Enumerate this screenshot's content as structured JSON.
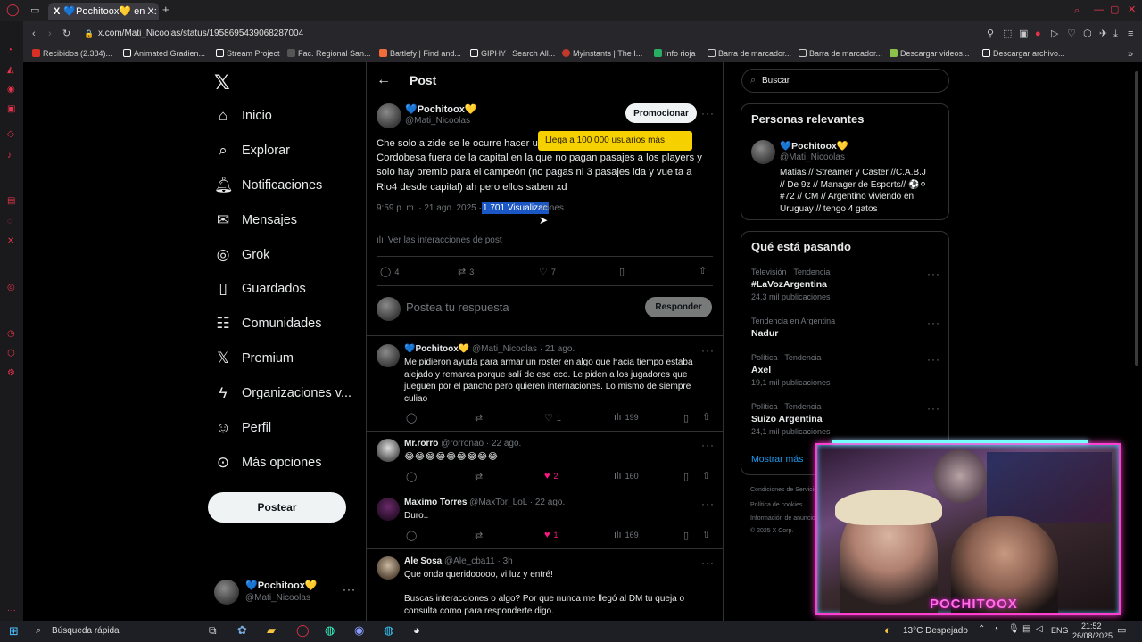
{
  "browser": {
    "tabs": [
      {
        "label": "💙Pochitoox💛 en X: \"Ch"
      }
    ],
    "url": "x.com/Mati_Nicoolas/status/1958695439068287004",
    "bookmarks": [
      {
        "label": "Recibidos (2.384)...",
        "color": "#d93025"
      },
      {
        "label": "Animated Gradien...",
        "color": "#ffffff"
      },
      {
        "label": "Stream Project",
        "color": "#ffffff"
      },
      {
        "label": "Fac. Regional San...",
        "color": "#555555"
      },
      {
        "label": "Battlefy | Find and...",
        "color": "#f26b3a"
      },
      {
        "label": "GIPHY | Search All...",
        "color": "#ffffff"
      },
      {
        "label": "Myinstants | The I...",
        "color": "#c0392b"
      },
      {
        "label": "Info rioja",
        "color": "#27ae60"
      },
      {
        "label": "Barra de marcador...",
        "color": "#cccccc"
      },
      {
        "label": "Barra de marcador...",
        "color": "#cccccc"
      },
      {
        "label": "Descargar videos...",
        "color": "#8bc34a"
      },
      {
        "label": "Descargar archivo...",
        "color": "#ffffff"
      }
    ]
  },
  "nav": {
    "items": [
      {
        "label": "Inicio",
        "icon": "home-icon",
        "glyph": "⌂"
      },
      {
        "label": "Explorar",
        "icon": "search-icon",
        "glyph": "⌕"
      },
      {
        "label": "Notificaciones",
        "icon": "bell-icon",
        "glyph": "♫"
      },
      {
        "label": "Mensajes",
        "icon": "mail-icon",
        "glyph": "✉"
      },
      {
        "label": "Grok",
        "icon": "grok-icon",
        "glyph": "◎"
      },
      {
        "label": "Guardados",
        "icon": "bookmark-icon",
        "glyph": "▯"
      },
      {
        "label": "Comunidades",
        "icon": "communities-icon",
        "glyph": "☷"
      },
      {
        "label": "Premium",
        "icon": "x-logo-icon",
        "glyph": "𝕏"
      },
      {
        "label": "Organizaciones v...",
        "icon": "lightning-icon",
        "glyph": "ϟ"
      },
      {
        "label": "Perfil",
        "icon": "person-icon",
        "glyph": "☺"
      },
      {
        "label": "Más opciones",
        "icon": "more-circle-icon",
        "glyph": "⊙"
      }
    ],
    "post_button": "Postear",
    "account": {
      "name": "💙Pochitoox💛",
      "handle": "@Mati_Nicoolas"
    }
  },
  "post": {
    "header_title": "Post",
    "author_name": "💙Pochitoox💛",
    "author_handle": "@Mati_Nicoolas",
    "promote_button": "Promocionar",
    "tooltip": "Llega a 100 000 usuarios más",
    "text_lines": [
      "Che solo a zide se le ocurre hacer u",
      "Cordobesa fuera de la capital en la que no pagan pasajes a los players y",
      "solo hay premio para el campeón (no pagas ni 3 pasajes ida y vuelta a",
      "Rio4 desde capital) ah pero ellos saben xd"
    ],
    "time": "9:59 p. m. · 21 ago. 2025 ·",
    "views_highlighted": "1.701 Visualizac",
    "views_rest": "iones",
    "interactions_link": "Ver las interacciones de post",
    "replies": "4",
    "reposts": "3",
    "likes": "7",
    "reply_placeholder": "Postea tu respuesta",
    "reply_button": "Responder"
  },
  "replies": [
    {
      "name": "💙Pochitoox💛",
      "handle": "@Mati_Nicoolas",
      "time": "· 21 ago.",
      "lines": [
        "Me pidieron ayuda para armar un roster en algo que hacia tiempo estaba",
        "alejado y remarca porque salí de ese eco. Le piden a los jugadores que",
        "jueguen por el pancho pero quieren internaciones. Lo mismo de siempre",
        "culiao"
      ],
      "likes": "1",
      "views": "199",
      "liked": false
    },
    {
      "name": "Mr.rorro",
      "handle": "@rorronao",
      "time": "· 22 ago.",
      "lines": [
        "😂😂😂😂😂😂😂😂😂"
      ],
      "likes": "2",
      "views": "160",
      "liked": true
    },
    {
      "name": "Maximo Torres",
      "handle": "@MaxTor_LoL",
      "time": "· 22 ago.",
      "lines": [
        "Duro.."
      ],
      "likes": "1",
      "views": "169",
      "liked": true
    },
    {
      "name": "Ale Sosa",
      "handle": "@Ale_cba11",
      "time": "· 3h",
      "lines": [
        "Que onda queridooooo, vi luz y entré!",
        "",
        "Buscas interacciones o algo? Por que nunca me llegó al DM tu queja o",
        "consulta como para responderte digo."
      ],
      "likes": "",
      "views": "",
      "liked": false
    }
  ],
  "sidebar": {
    "search_placeholder": "Buscar",
    "relevant_title": "Personas relevantes",
    "relevant_name": "💙Pochitoox💛",
    "relevant_handle": "@Mati_Nicoolas",
    "relevant_bio": [
      "Matias // Streamer y Caster //C.A.B.J",
      "// De 9z // Manager de Esports// ⚽⚪",
      "#72 // CM // Argentino viviendo en",
      "Uruguay // tengo 4 gatos"
    ],
    "trending_title": "Qué está pasando",
    "trends": [
      {
        "context": "Televisión · Tendencia",
        "name": "#LaVozArgentina",
        "count": "24,3 mil publicaciones"
      },
      {
        "context": "Tendencia en Argentina",
        "name": "Nadur",
        "count": ""
      },
      {
        "context": "Política · Tendencia",
        "name": "Axel",
        "count": "19,1 mil publicaciones"
      },
      {
        "context": "Política · Tendencia",
        "name": "Suizo Argentina",
        "count": "24,1 mil publicaciones"
      }
    ],
    "show_more": "Mostrar más",
    "footer": [
      "Condiciones de Servicio",
      "Política de cookies",
      "Información de anuncios",
      "© 2025 X Corp."
    ]
  },
  "webcam": {
    "overlay_text": "POCHITOOX"
  },
  "taskbar": {
    "search": "Búsqueda rápida",
    "weather": "13°C  Despejado",
    "lang": "ENG",
    "time": "21:52",
    "date": "26/08/2025"
  }
}
